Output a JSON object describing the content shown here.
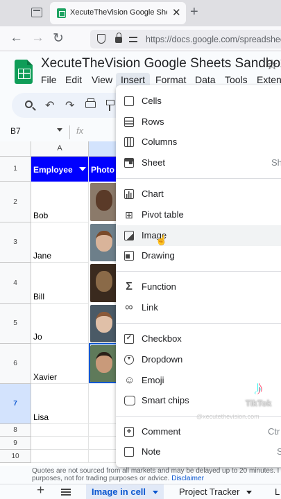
{
  "browser": {
    "tab_title": "XecuteTheVision Google Sheets S",
    "tab_close": "✕",
    "new_tab": "+",
    "url": "https://docs.google.com/spreadsheet"
  },
  "app": {
    "title": "XecuteTheVision Google Sheets Sandbox",
    "menus": [
      "File",
      "Edit",
      "View",
      "Insert",
      "Format",
      "Data",
      "Tools",
      "Extens"
    ],
    "active_menu": "Insert",
    "name_box": "B7",
    "fx": "fx"
  },
  "grid": {
    "column_headers": [
      "A"
    ],
    "header_row": [
      "Employee",
      "Photo"
    ],
    "row_numbers": [
      "1",
      "2",
      "3",
      "4",
      "5",
      "6",
      "7",
      "8",
      "9",
      "10"
    ],
    "selected_row": "7",
    "selected_cell": "B7",
    "employees": [
      "Bob",
      "Jane",
      "Bill",
      "Jo",
      "Xavier",
      "Lisa"
    ],
    "header_fill": "#0000ff"
  },
  "disclaimer": {
    "line1": "Quotes are not sourced from all markets and may be delayed up to 20 minutes. I",
    "line2": "purposes, not for trading purposes or advice.",
    "link": "Disclaimer"
  },
  "sheet_tabs": {
    "add": "+",
    "tabs": [
      "Image in cell",
      "Project Tracker",
      "L"
    ],
    "active": "Image in cell"
  },
  "insert_menu": {
    "groups": [
      [
        {
          "label": "Cells",
          "icon": "cells-icon",
          "shortcut": ""
        },
        {
          "label": "Rows",
          "icon": "rows-icon",
          "shortcut": ""
        },
        {
          "label": "Columns",
          "icon": "columns-icon",
          "shortcut": ""
        },
        {
          "label": "Sheet",
          "icon": "sheet-icon",
          "shortcut": "Sh"
        }
      ],
      [
        {
          "label": "Chart",
          "icon": "chart-icon",
          "shortcut": ""
        },
        {
          "label": "Pivot table",
          "icon": "pivot-table-icon",
          "shortcut": ""
        },
        {
          "label": "Image",
          "icon": "image-icon",
          "shortcut": ""
        },
        {
          "label": "Drawing",
          "icon": "drawing-icon",
          "shortcut": ""
        }
      ],
      [
        {
          "label": "Function",
          "icon": "sigma-icon",
          "shortcut": ""
        },
        {
          "label": "Link",
          "icon": "link-icon",
          "shortcut": ""
        }
      ],
      [
        {
          "label": "Checkbox",
          "icon": "checkbox-icon",
          "shortcut": ""
        },
        {
          "label": "Dropdown",
          "icon": "dropdown-icon",
          "shortcut": ""
        },
        {
          "label": "Emoji",
          "icon": "emoji-icon",
          "shortcut": ""
        },
        {
          "label": "Smart chips",
          "icon": "smart-chips-icon",
          "shortcut": ""
        }
      ],
      [
        {
          "label": "Comment",
          "icon": "comment-icon",
          "shortcut": "Ctr"
        },
        {
          "label": "Note",
          "icon": "note-icon",
          "shortcut": "S"
        }
      ]
    ],
    "hovered": "Image"
  },
  "watermark": {
    "brand": "TikTok",
    "handle": "@xecutethevision.com"
  }
}
